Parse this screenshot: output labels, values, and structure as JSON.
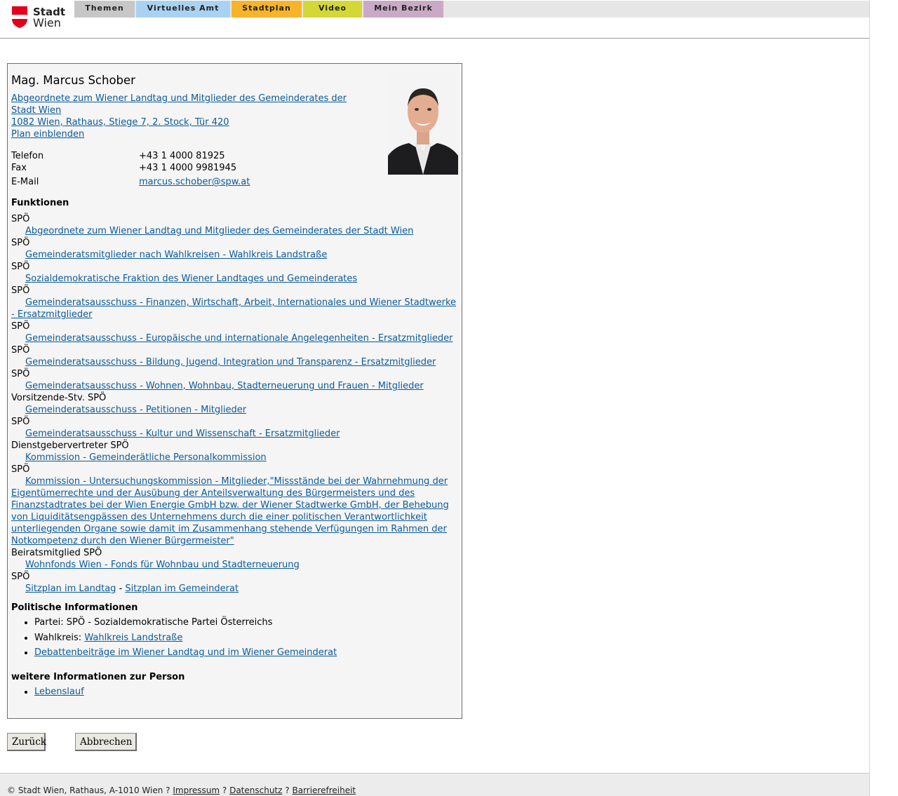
{
  "header": {
    "logo_line1": "Stadt",
    "logo_line2": "Wien",
    "colors": {
      "logo_red": "#e2001a"
    },
    "tabs": [
      {
        "label": "Themen",
        "color": "#c7c7c7"
      },
      {
        "label": "Virtuelles Amt",
        "color": "#a9d2f0"
      },
      {
        "label": "Stadtplan",
        "color": "#f7b42a"
      },
      {
        "label": "Video",
        "color": "#d4d836"
      },
      {
        "label": "Mein Bezirk",
        "color": "#c9a9c6"
      }
    ]
  },
  "person": {
    "name": "Mag. Marcus Schober",
    "address_line1": "Abgeordnete zum Wiener Landtag und Mitglieder des Gemeinderates der Stadt Wien",
    "address_line2": "1082 Wien, Rathaus, Stiege 7, 2. Stock, Tür 420",
    "plan_link": "Plan einblenden",
    "phone_label": "Telefon",
    "phone": "+43 1 4000 81925",
    "fax_label": "Fax",
    "fax": "+43 1 4000 9981945",
    "email_label": "E-Mail",
    "email": "marcus.schober@spw.at"
  },
  "functions": {
    "title": "Funktionen",
    "items": [
      {
        "label": "SPÖ",
        "link": "Abgeordnete zum Wiener Landtag und Mitglieder des Gemeinderates der Stadt Wien"
      },
      {
        "label": "SPÖ",
        "link": "Gemeinderatsmitglieder nach Wahlkreisen - Wahlkreis Landstraße"
      },
      {
        "label": "SPÖ",
        "link": "Sozialdemokratische Fraktion des Wiener Landtages und Gemeinderates"
      },
      {
        "label": "SPÖ",
        "link": "Gemeinderatsausschuss - Finanzen, Wirtschaft, Arbeit, Internationales und Wiener Stadtwerke - Ersatzmitglieder"
      },
      {
        "label": "SPÖ",
        "link": "Gemeinderatsausschuss - Europäische und internationale Angelegenheiten - Ersatzmitglieder"
      },
      {
        "label": "SPÖ",
        "link": "Gemeinderatsausschuss - Bildung, Jugend, Integration und Transparenz - Ersatzmitglieder"
      },
      {
        "label": "SPÖ",
        "link": "Gemeinderatsausschuss - Wohnen, Wohnbau, Stadterneuerung und Frauen - Mitglieder"
      },
      {
        "label": "Vorsitzende-Stv. SPÖ",
        "link": "Gemeinderatsausschuss - Petitionen - Mitglieder"
      },
      {
        "label": "SPÖ",
        "link": "Gemeinderatsausschuss - Kultur und Wissenschaft - Ersatzmitglieder"
      },
      {
        "label": "Dienstgebervertreter SPÖ",
        "link": "Kommission - Gemeinderätliche Personalkommission"
      },
      {
        "label": "SPÖ",
        "link": "Kommission - Untersuchungskommission - Mitglieder,\"Missstände bei der Wahrnehmung der Eigentümerrechte und der Ausübung der Anteilsverwaltung des Bürgermeisters und des Finanzstadtrates bei der Wien Energie GmbH bzw. der Wiener Stadtwerke GmbH, der Behebung von Liquiditätsengpässen des Unternehmens durch die einer politischen Verantwortlichkeit unterliegenden Organe sowie damit im Zusammenhang stehende Verfügungen im Rahmen der Notkompetenz durch den Wiener Bürgermeister\""
      },
      {
        "label": "Beiratsmitglied SPÖ",
        "link": "Wohnfonds Wien - Fonds für Wohnbau und Stadterneuerung"
      }
    ],
    "last_label": "SPÖ",
    "seat_landtag": "Sitzplan im Landtag",
    "seat_sep": "-",
    "seat_gemeinderat": "Sitzplan im Gemeinderat"
  },
  "political": {
    "title": "Politische Informationen",
    "party": "Partei: SPÖ - Sozialdemokratische Partei Österreichs",
    "district_label": "Wahlkreis:",
    "district_link": "Wahlkreis Landstraße",
    "debates_link": "Debattenbeiträge im Wiener Landtag und im Wiener Gemeinderat"
  },
  "more": {
    "title": "weitere Informationen zur Person",
    "cv_link": "Lebenslauf"
  },
  "buttons": {
    "back": "Zurück",
    "cancel": "Abbrechen"
  },
  "footer": {
    "copyright": "© Stadt Wien, Rathaus, A-1010 Wien",
    "sep": "?",
    "impressum": "Impressum",
    "datenschutz": "Datenschutz",
    "barrierefreiheit": "Barrierefreiheit"
  }
}
